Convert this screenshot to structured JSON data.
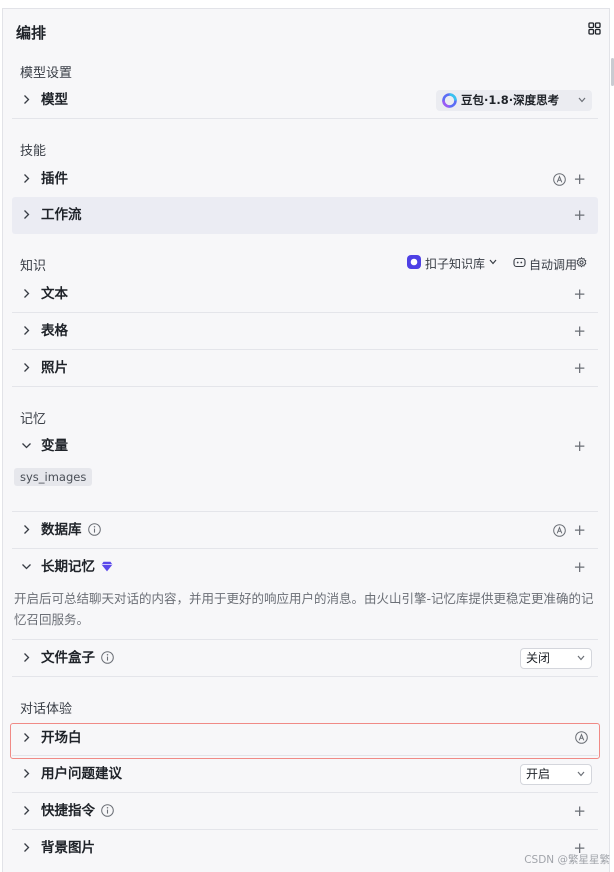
{
  "header": {
    "title": "编排",
    "layout_icon": "grid-icon"
  },
  "sections": {
    "model": "模型设置",
    "skills": "技能",
    "knowledge": "知识",
    "memory": "记忆",
    "experience": "对话体验"
  },
  "model_row": {
    "label": "模型",
    "model_name": "豆包·1.8·深度思考",
    "model_icon": "doubao-logo-icon"
  },
  "skills_rows": {
    "plugin": "插件",
    "workflow": "工作流"
  },
  "knowledge_bar": {
    "kb_label": "扣子知识库",
    "auto_label": "自动调用"
  },
  "knowledge_rows": {
    "text": "文本",
    "table": "表格",
    "photo": "照片"
  },
  "memory_rows": {
    "variable": "变量",
    "variable_tag": "sys_images",
    "database": "数据库",
    "long_term": "长期记忆",
    "long_term_desc": "开启后可总结聊天对话的内容，并用于更好的响应用户的消息。由火山引擎-记忆库提供更稳定更准确的记忆召回服务。",
    "file_box": "文件盒子",
    "file_box_value": "关闭"
  },
  "experience_rows": {
    "opening": "开场白",
    "suggestions": "用户问题建议",
    "suggestions_value": "开启",
    "shortcuts": "快捷指令",
    "background": "背景图片"
  },
  "watermark": "CSDN @繁星星繁",
  "colors": {
    "accent": "#4e40e5",
    "highlight_border": "#f08a86",
    "row_highlight": "#ebecf3"
  }
}
